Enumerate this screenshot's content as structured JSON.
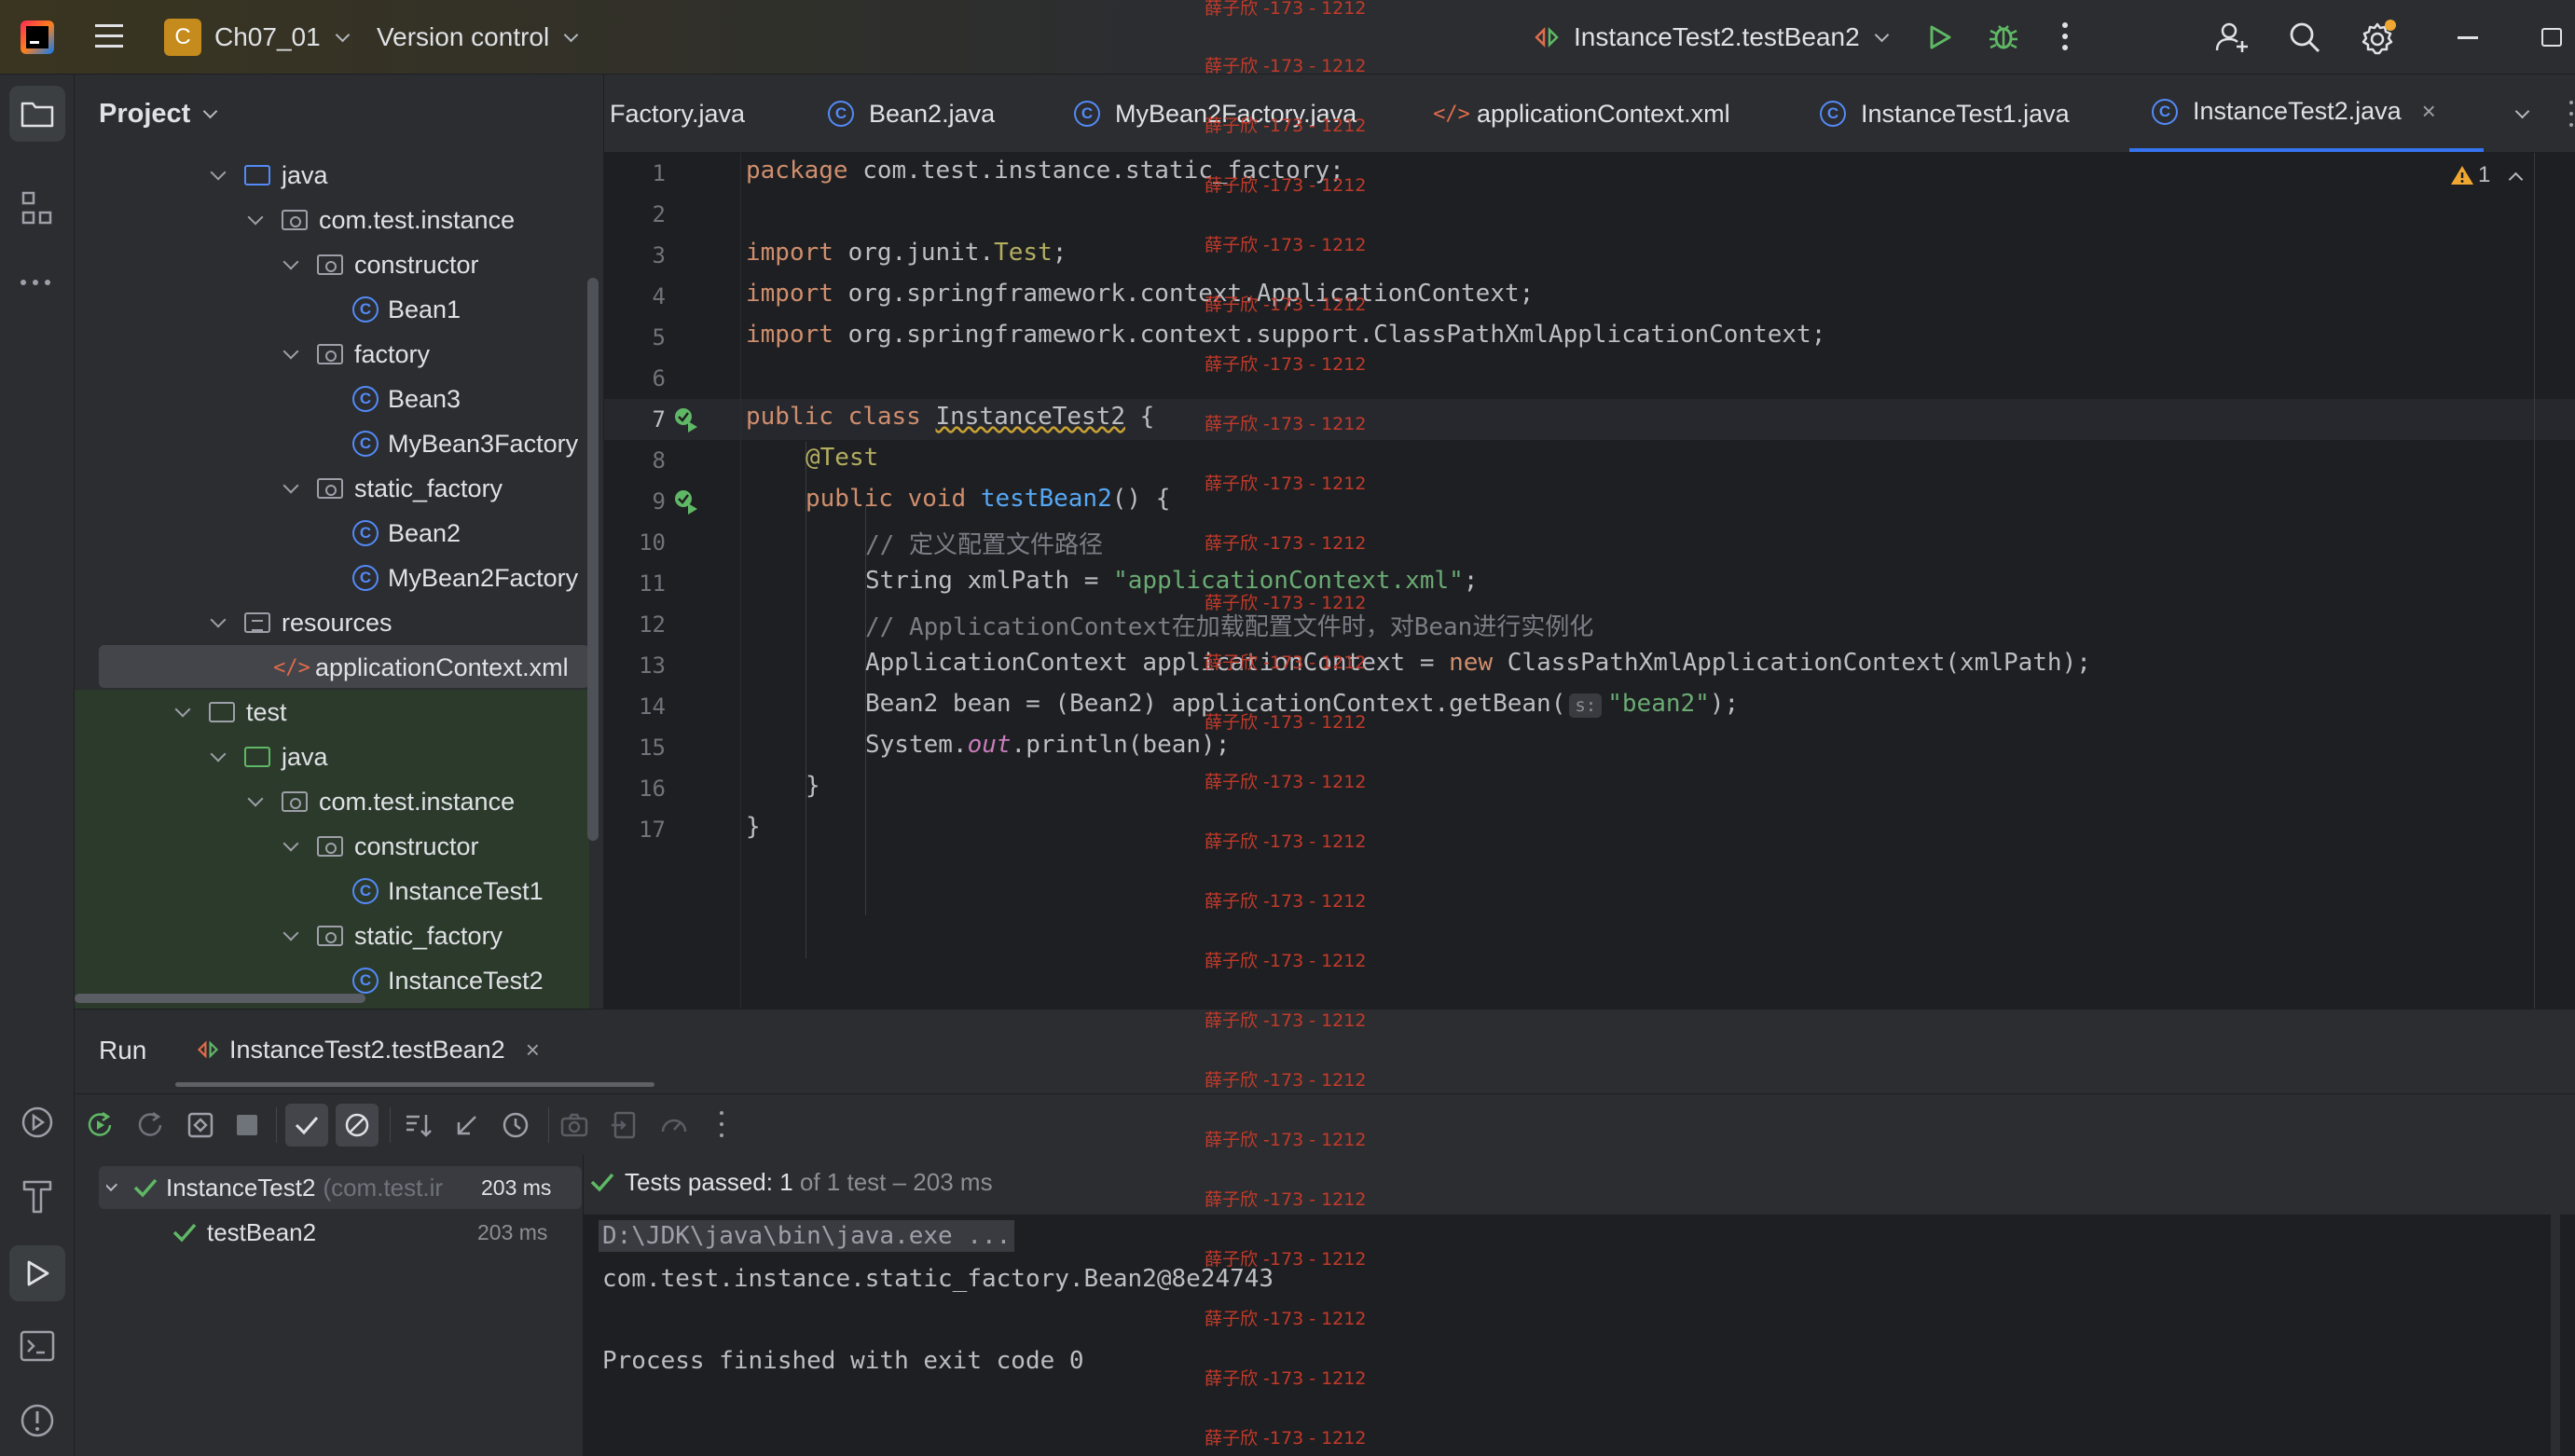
{
  "app": {
    "project_name": "Ch07_01",
    "project_initial": "C",
    "vcs_label": "Version control",
    "run_config": "InstanceTest2.testBean2"
  },
  "project_panel": {
    "title": "Project",
    "tree": [
      {
        "label": "java",
        "kind": "folder-blue"
      },
      {
        "label": "com.test.instance",
        "kind": "package"
      },
      {
        "label": "constructor",
        "kind": "package"
      },
      {
        "label": "Bean1",
        "kind": "class"
      },
      {
        "label": "factory",
        "kind": "package"
      },
      {
        "label": "Bean3",
        "kind": "class"
      },
      {
        "label": "MyBean3Factory",
        "kind": "class"
      },
      {
        "label": "static_factory",
        "kind": "package"
      },
      {
        "label": "Bean2",
        "kind": "class"
      },
      {
        "label": "MyBean2Factory",
        "kind": "class"
      },
      {
        "label": "resources",
        "kind": "resources"
      },
      {
        "label": "applicationContext.xml",
        "kind": "xml",
        "selected": true
      },
      {
        "label": "test",
        "kind": "folder"
      },
      {
        "label": "java",
        "kind": "folder-green"
      },
      {
        "label": "com.test.instance",
        "kind": "package"
      },
      {
        "label": "constructor",
        "kind": "package"
      },
      {
        "label": "InstanceTest1",
        "kind": "class"
      },
      {
        "label": "static_factory",
        "kind": "package"
      },
      {
        "label": "InstanceTest2",
        "kind": "class"
      }
    ]
  },
  "tabs": [
    {
      "label": "Factory.java",
      "icon": "none"
    },
    {
      "label": "Bean2.java",
      "icon": "class-icon"
    },
    {
      "label": "MyBean2Factory.java",
      "icon": "class-icon"
    },
    {
      "label": "applicationContext.xml",
      "icon": "xml-icon"
    },
    {
      "label": "InstanceTest1.java",
      "icon": "class-icon"
    },
    {
      "label": "InstanceTest2.java",
      "icon": "class-icon",
      "active": true
    }
  ],
  "editor": {
    "warning_count": "1",
    "line_numbers": [
      "1",
      "2",
      "3",
      "4",
      "5",
      "6",
      "7",
      "8",
      "9",
      "10",
      "11",
      "12",
      "13",
      "14",
      "15",
      "16",
      "17"
    ],
    "lines": {
      "l1_kw": "package",
      "l1_rest": " com.test.instance.static_factory;",
      "l3_kw": "import",
      "l3_rest": " org.junit.",
      "l3_ann": "Test",
      "l3_end": ";",
      "l4_kw": "import",
      "l4_rest": " org.springframework.context.ApplicationContext;",
      "l5_kw": "import",
      "l5_rest": " org.springframework.context.support.ClassPathXmlApplicationContext;",
      "l7_kw": "public class",
      "l7_sp": " ",
      "l7_name": "InstanceTest2",
      "l7_end": " {",
      "l8_ann": "@Test",
      "l9_kw": "public void",
      "l9_sp": " ",
      "l9_fn": "testBean2",
      "l9_end": "() {",
      "l10_cm": "// 定义配置文件路径",
      "l11_a": "String xmlPath = ",
      "l11_str": "\"applicationContext.xml\"",
      "l11_end": ";",
      "l12_cm": "// ApplicationContext在加载配置文件时，对Bean进行实例化",
      "l13_a": "ApplicationContext applicationContext = ",
      "l13_kw": "new",
      "l13_end": " ClassPathXmlApplicationContext(xmlPath);",
      "l14_a": "Bean2 bean = (Bean2) applicationContext.getBean(",
      "l14_hint": "s:",
      "l14_str": "\"bean2\"",
      "l14_end": ");",
      "l15_a": "System.",
      "l15_it": "out",
      "l15_end": ".println(bean);",
      "l16": "}",
      "l17": "}"
    }
  },
  "run_panel": {
    "title": "Run",
    "tab_label": "InstanceTest2.testBean2",
    "tests": [
      {
        "name": "InstanceTest2",
        "detail": "(com.test.ir",
        "time": "203 ms"
      },
      {
        "name": "testBean2",
        "detail": "",
        "time": "203 ms"
      }
    ],
    "status_prefix": "Tests passed: ",
    "status_count": "1",
    "status_suffix": " of 1 test – 203 ms",
    "console": [
      "D:\\JDK\\java\\bin\\java.exe ...",
      "com.test.instance.static_factory.Bean2@8e24743",
      "",
      "Process finished with exit code 0"
    ]
  },
  "watermark": "薛子欣 -173 - 1212",
  "colors": {
    "accent": "#3574f0",
    "keyword": "#cf8e6d",
    "string": "#6aab73",
    "success": "#5fb865",
    "watermark": "#c33a2a"
  }
}
